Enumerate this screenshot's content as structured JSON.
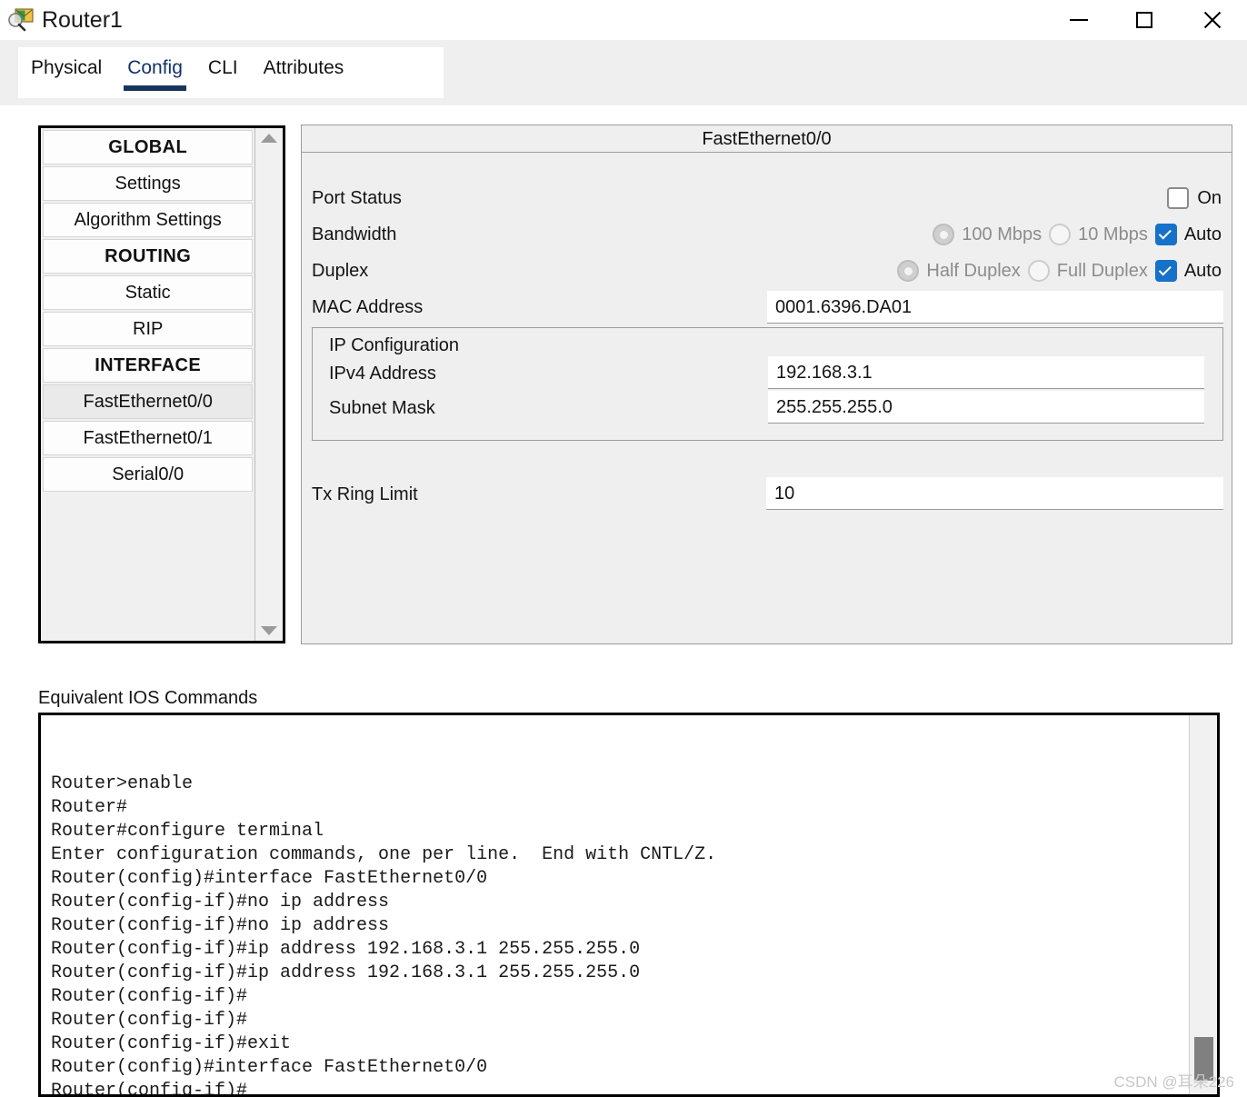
{
  "window": {
    "title": "Router1",
    "icon": "router-packet-icon",
    "controls": {
      "minimize": "minimize-icon",
      "maximize": "maximize-icon",
      "close": "close-icon"
    }
  },
  "tabs": [
    {
      "label": "Physical",
      "active": false
    },
    {
      "label": "Config",
      "active": true
    },
    {
      "label": "CLI",
      "active": false
    },
    {
      "label": "Attributes",
      "active": false
    }
  ],
  "sidebar": {
    "items": [
      {
        "label": "GLOBAL",
        "type": "header",
        "selected": false
      },
      {
        "label": "Settings",
        "type": "item",
        "selected": false
      },
      {
        "label": "Algorithm Settings",
        "type": "item",
        "selected": false
      },
      {
        "label": "ROUTING",
        "type": "header",
        "selected": false
      },
      {
        "label": "Static",
        "type": "item",
        "selected": false
      },
      {
        "label": "RIP",
        "type": "item",
        "selected": false
      },
      {
        "label": "INTERFACE",
        "type": "header",
        "selected": false
      },
      {
        "label": "FastEthernet0/0",
        "type": "item",
        "selected": true
      },
      {
        "label": "FastEthernet0/1",
        "type": "item",
        "selected": false
      },
      {
        "label": "Serial0/0",
        "type": "item",
        "selected": false
      }
    ],
    "scroll_up": "scroll-up-arrow",
    "scroll_down": "scroll-down-arrow"
  },
  "config": {
    "header": "FastEthernet0/0",
    "port_status": {
      "label": "Port Status",
      "on_label": "On",
      "checked": false
    },
    "bandwidth": {
      "label": "Bandwidth",
      "option_100": "100 Mbps",
      "option_10": "10 Mbps",
      "auto_label": "Auto",
      "selected": "100 Mbps",
      "auto_checked": true
    },
    "duplex": {
      "label": "Duplex",
      "option_half": "Half Duplex",
      "option_full": "Full Duplex",
      "auto_label": "Auto",
      "selected": "Half Duplex",
      "auto_checked": true
    },
    "mac_address": {
      "label": "MAC Address",
      "value": "0001.6396.DA01"
    },
    "ip_configuration": {
      "title": "IP Configuration",
      "ipv4_label": "IPv4 Address",
      "ipv4_value": "192.168.3.1",
      "subnet_label": "Subnet Mask",
      "subnet_value": "255.255.255.0"
    },
    "tx_ring_limit": {
      "label": "Tx Ring Limit",
      "value": "10"
    }
  },
  "ios": {
    "label": "Equivalent IOS Commands",
    "lines": "Router>enable\nRouter#\nRouter#configure terminal\nEnter configuration commands, one per line.  End with CNTL/Z.\nRouter(config)#interface FastEthernet0/0\nRouter(config-if)#no ip address\nRouter(config-if)#no ip address\nRouter(config-if)#ip address 192.168.3.1 255.255.255.0\nRouter(config-if)#ip address 192.168.3.1 255.255.255.0\nRouter(config-if)#\nRouter(config-if)#\nRouter(config-if)#exit\nRouter(config)#interface FastEthernet0/0\nRouter(config-if)#"
  },
  "watermark": "CSDN @耳朵226",
  "colors": {
    "accent_checkbox": "#1572c8",
    "tab_active_underline": "#17355e",
    "panel_background": "#efefef"
  }
}
